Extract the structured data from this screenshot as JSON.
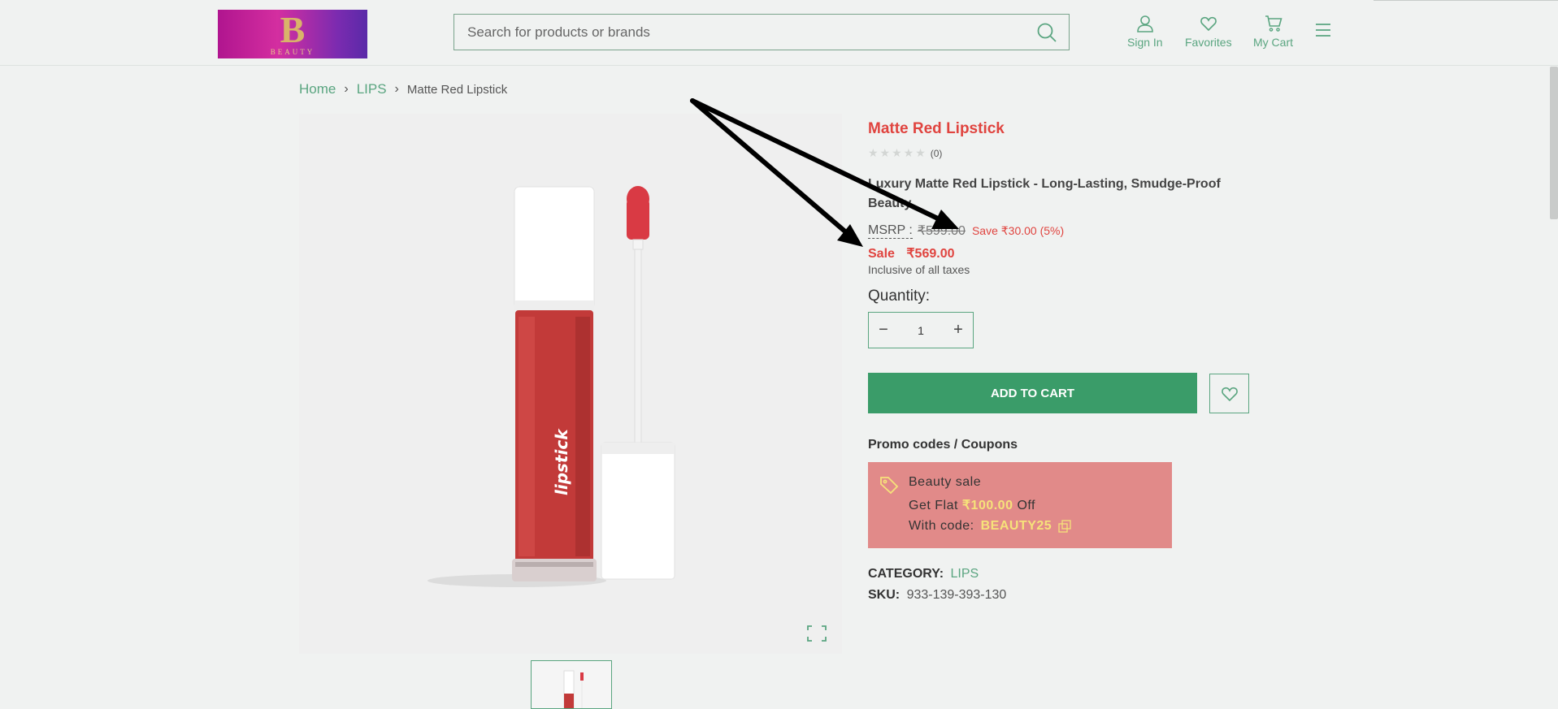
{
  "header": {
    "logo_letter": "B",
    "logo_text": "BEAUTY",
    "search_placeholder": "Search for products or brands",
    "sign_in": "Sign In",
    "favorites": "Favorites",
    "cart": "My Cart",
    "icons": [
      "search-icon",
      "user-icon",
      "heart-icon",
      "cart-icon",
      "menu-icon"
    ]
  },
  "breadcrumb": {
    "home": "Home",
    "category": "LIPS",
    "current": "Matte Red Lipstick"
  },
  "product": {
    "title": "Matte Red Lipstick",
    "stars": "★★★★★",
    "review_count": "(0)",
    "rating": 0,
    "description": "Luxury Matte Red Lipstick - Long-Lasting, Smudge-Proof Beauty",
    "image_brand_text": "lipstick"
  },
  "pricing": {
    "msrp_label": "MSRP :",
    "msrp_value": "₹599.00",
    "save_text": "Save ₹30.00 (5%)",
    "sale_label": "Sale",
    "sale_price": "₹569.00",
    "tax_note": "Inclusive of all taxes"
  },
  "quantity": {
    "label": "Quantity:",
    "value": "1",
    "minus": "−",
    "plus": "+"
  },
  "actions": {
    "add_to_cart": "ADD TO CART"
  },
  "promo": {
    "title": "Promo codes / Coupons",
    "name": "Beauty sale",
    "flat_prefix": "Get Flat",
    "amount": "₹100.00",
    "flat_suffix": "Off",
    "code_label": "With code:",
    "code": "BEAUTY25"
  },
  "meta": {
    "category_label": "CATEGORY:",
    "category_value": "LIPS",
    "sku_label": "SKU:",
    "sku_value": "933-139-393-130"
  },
  "colors": {
    "accent": "#5aa580",
    "button": "#3a9c69",
    "title_red": "#e0443f",
    "promo_bg": "#e18a89",
    "promo_highlight": "#f6e27a"
  }
}
